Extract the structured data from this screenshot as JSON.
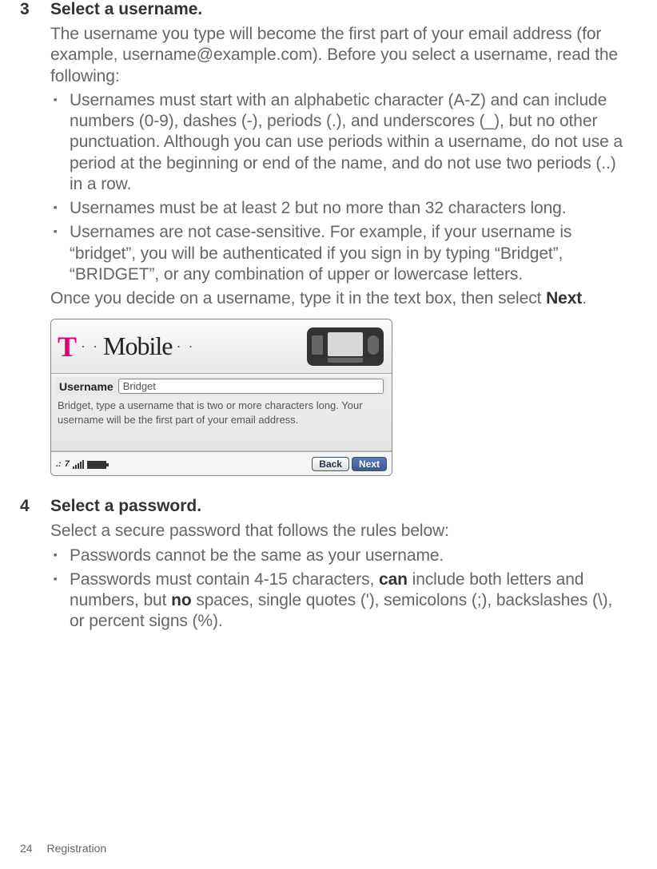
{
  "step3": {
    "num": "3",
    "title": "Select a username.",
    "intro": "The username you type will become the first part of your email address (for example, username@example.com). Before you select a username, read the following:",
    "bullets": [
      "Usernames must start with an alphabetic character (A-Z) and can include numbers (0-9), dashes (-), periods (.), and underscores (_), but no other punctuation. Although you can use periods within a username, do not use a period at the beginning or end of the name, and do not use two periods (..) in a row.",
      "Usernames must be at least 2 but no more than 32 characters long.",
      "Usernames are not case-sensitive. For example, if your username is “bridget”, you will be authenticated if you sign in by typing “Bridget”, “BRIDGET”, or any combination of upper or lowercase letters."
    ],
    "outro_pre": "Once you decide on a username, type it in the text box, then select ",
    "outro_bold": "Next",
    "outro_post": "."
  },
  "screenshot": {
    "logo_t": "T",
    "logo_mobile": "Mobile",
    "field_label": "Username",
    "field_value": "Bridget",
    "hint": "Bridget, type a username that is two or more characters long. Your username will be the first part of your email address.",
    "back": "Back",
    "next": "Next"
  },
  "step4": {
    "num": "4",
    "title": "Select a password.",
    "intro": "Select a secure password that follows the rules below:",
    "bullet1": "Passwords cannot be the same as your username.",
    "bullet2_pre": "Passwords must contain 4-15 characters, ",
    "bullet2_b1": "can",
    "bullet2_mid": " include both letters and numbers, but ",
    "bullet2_b2": "no",
    "bullet2_post": " spaces, single quotes ('), semicolons (;), backslashes (\\), or percent signs (%)."
  },
  "footer": {
    "page": "24",
    "section": "Registration"
  }
}
